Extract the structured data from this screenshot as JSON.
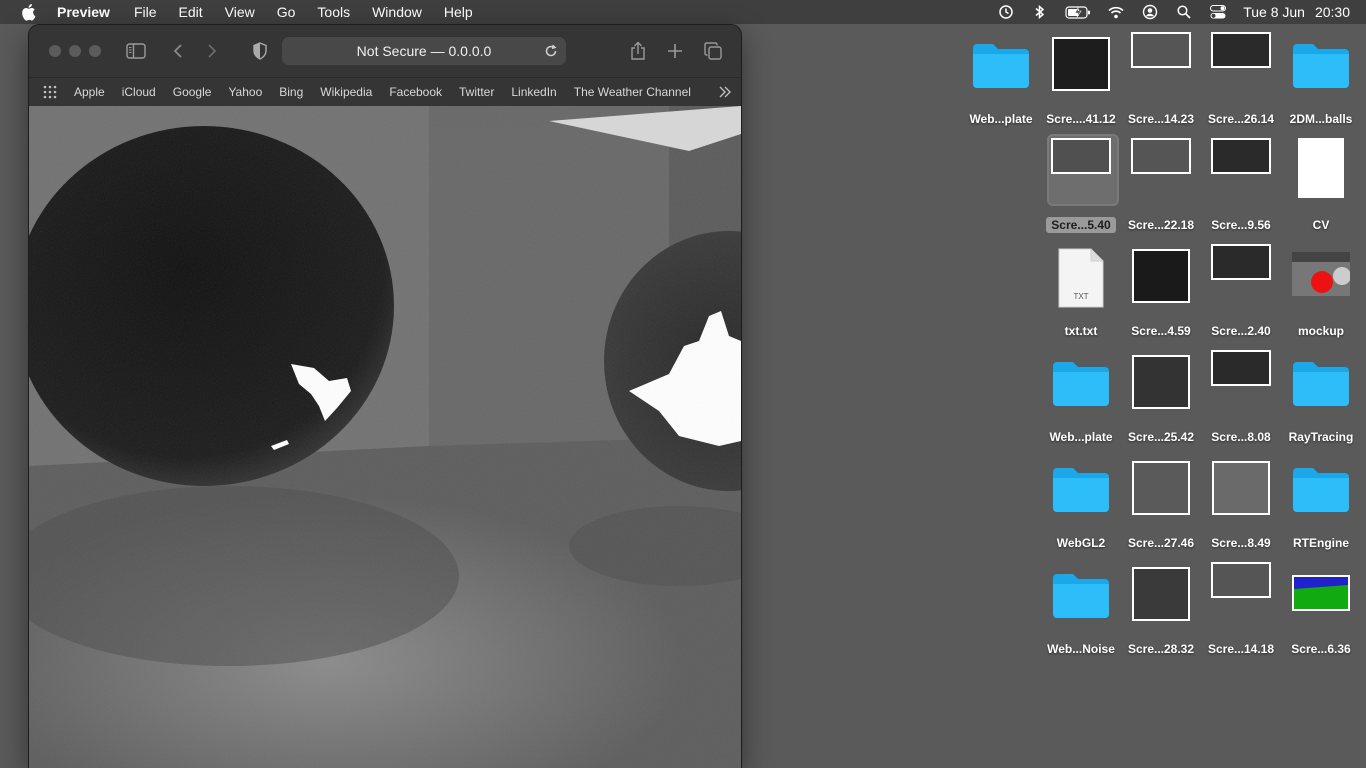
{
  "menubar": {
    "apple_icon": "apple-logo-icon",
    "app_name": "Preview",
    "menus": [
      "File",
      "Edit",
      "View",
      "Go",
      "Tools",
      "Window",
      "Help"
    ],
    "status_icons": [
      "time-machine-icon",
      "bluetooth-icon",
      "battery-charging-icon",
      "wifi-icon",
      "user-account-icon",
      "spotlight-search-icon",
      "control-center-icon"
    ],
    "date": "Tue 8 Jun",
    "time": "20:30"
  },
  "browser": {
    "address": "Not Secure — 0.0.0.0",
    "favorites": [
      "Apple",
      "iCloud",
      "Google",
      "Yahoo",
      "Bing",
      "Wikipedia",
      "Facebook",
      "Twitter",
      "LinkedIn",
      "The Weather Channel"
    ],
    "content_description_color": "#6b6b6b"
  },
  "desktop": {
    "icons": [
      {
        "label": "Web...plate",
        "kind": "folder"
      },
      {
        "label": "Scre....41.12",
        "kind": "screenshot"
      },
      {
        "label": "Scre...14.23",
        "kind": "screenshot"
      },
      {
        "label": "Scre...26.14",
        "kind": "screenshot"
      },
      {
        "label": "2DM...balls",
        "kind": "folder"
      },
      {
        "label": "Scre...5.40",
        "kind": "screenshot",
        "selected": true
      },
      {
        "label": "Scre...22.18",
        "kind": "screenshot"
      },
      {
        "label": "Scre...9.56",
        "kind": "screenshot"
      },
      {
        "label": "CV",
        "kind": "document"
      },
      {
        "label": "txt.txt",
        "kind": "text-file",
        "badge": "TXT"
      },
      {
        "label": "Scre...4.59",
        "kind": "screenshot"
      },
      {
        "label": "Scre...2.40",
        "kind": "screenshot"
      },
      {
        "label": "mockup",
        "kind": "image"
      },
      {
        "label": "Web...plate",
        "kind": "folder"
      },
      {
        "label": "Scre...25.42",
        "kind": "screenshot"
      },
      {
        "label": "Scre...8.08",
        "kind": "screenshot"
      },
      {
        "label": "RayTracing",
        "kind": "folder"
      },
      {
        "label": "WebGL2",
        "kind": "folder"
      },
      {
        "label": "Scre...27.46",
        "kind": "screenshot"
      },
      {
        "label": "Scre...8.49",
        "kind": "screenshot"
      },
      {
        "label": "RTEngine",
        "kind": "folder"
      },
      {
        "label": "Web...Noise",
        "kind": "folder"
      },
      {
        "label": "Scre...28.32",
        "kind": "screenshot"
      },
      {
        "label": "Scre...14.18",
        "kind": "screenshot"
      },
      {
        "label": "Scre...6.36",
        "kind": "screenshot"
      }
    ]
  },
  "colors": {
    "desktop_bg": "#5a5a5a",
    "folder_blue": "#1fb2f4",
    "menubar_bg": "#3f3f3f"
  }
}
